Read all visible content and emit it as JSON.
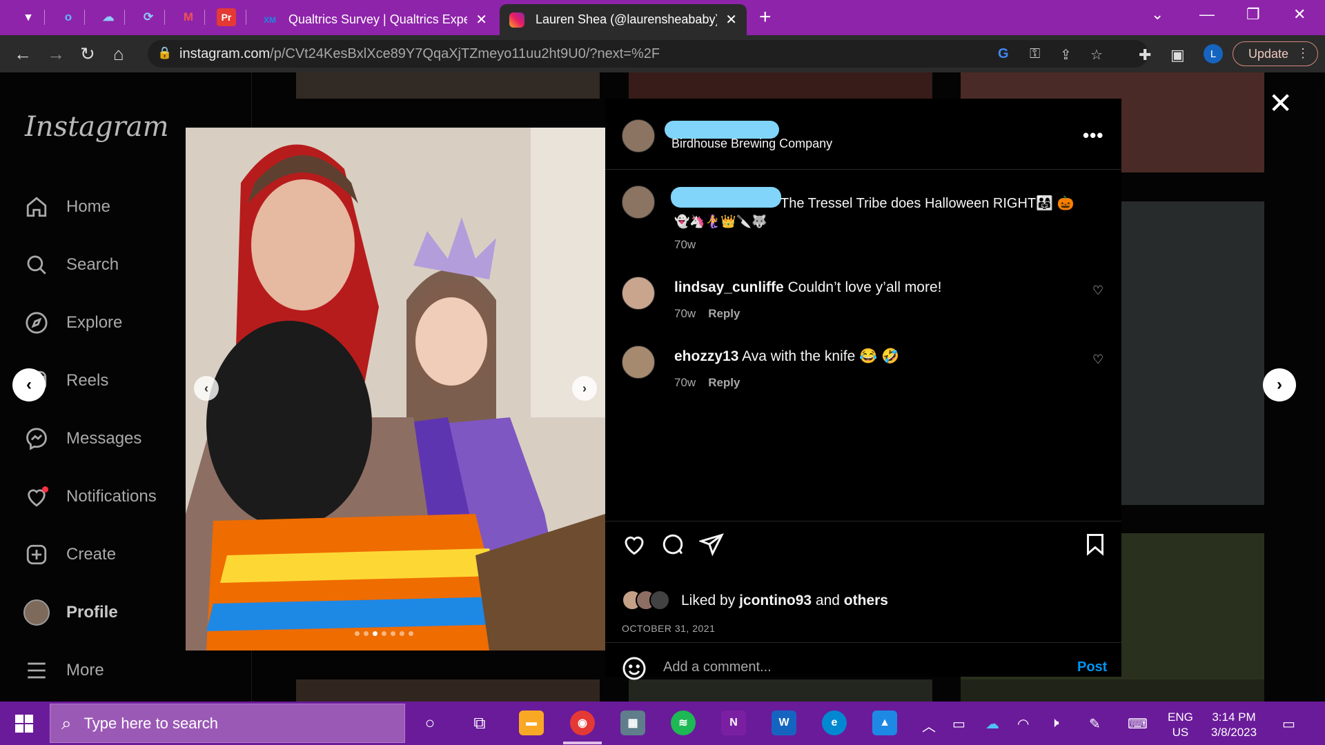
{
  "browser": {
    "tabs": [
      {
        "title": "Qualtrics Survey | Qualtrics Exper",
        "icon": "XM"
      },
      {
        "title": "Lauren Shea (@laurensheababy)",
        "icon": "instagram-icon"
      }
    ],
    "url_host": "instagram.com",
    "url_path": "/p/CVt24KesBxlXce89Y7QqaXjTZmeyo11uu2ht9U0/?next=%2F",
    "profile_initial": "L",
    "update_label": "Update"
  },
  "instagram": {
    "logo": "Instagram",
    "nav": [
      {
        "label": "Home",
        "icon": "home-icon"
      },
      {
        "label": "Search",
        "icon": "search-icon"
      },
      {
        "label": "Explore",
        "icon": "compass-icon"
      },
      {
        "label": "Reels",
        "icon": "reels-icon"
      },
      {
        "label": "Messages",
        "icon": "messenger-icon"
      },
      {
        "label": "Notifications",
        "icon": "heart-icon"
      },
      {
        "label": "Create",
        "icon": "plus-square-icon"
      },
      {
        "label": "Profile",
        "icon": "avatar"
      },
      {
        "label": "More",
        "icon": "hamburger-icon"
      }
    ]
  },
  "post": {
    "location": "Birdhouse Brewing Company",
    "caption_text": "The Tressel Tribe does Halloween RIGHT👨‍👩‍👧 🎃",
    "caption_emojis": "👻🦄🧜‍♀️👑🔪🐺",
    "caption_age": "70w",
    "comments": [
      {
        "user": "lindsay_cunliffe",
        "text": "Couldn’t love y’all more!",
        "age": "70w",
        "reply": "Reply"
      },
      {
        "user": "ehozzy13",
        "text": "Ava with the knife 😂 🤣",
        "age": "70w",
        "reply": "Reply"
      }
    ],
    "liked_prefix": "Liked by ",
    "liked_user": "jcontino93",
    "liked_and": " and ",
    "liked_others": "others",
    "date": "OCTOBER 31, 2021",
    "comment_placeholder": "Add a comment...",
    "post_button": "Post",
    "carousel_total": 7,
    "carousel_active": 3
  },
  "taskbar": {
    "search_placeholder": "Type here to search",
    "lang_top": "ENG",
    "lang_bottom": "US",
    "time": "3:14 PM",
    "date": "3/8/2023"
  },
  "colors": {
    "tabstrip": "#8e24aa",
    "taskbar": "#6a1b9a",
    "instagram_link": "#0095f6",
    "redaction": "#81d4fa"
  }
}
